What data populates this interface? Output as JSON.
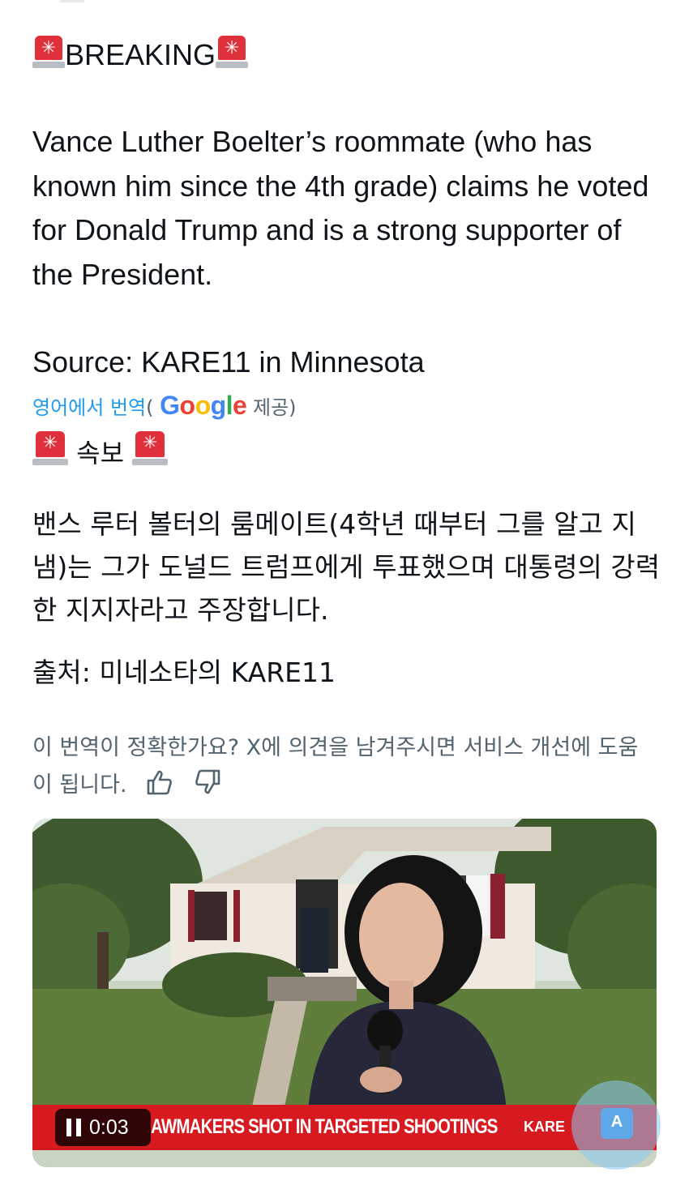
{
  "colors": {
    "link": "#1d9bf0",
    "muted": "#536471",
    "text": "#0f1419",
    "ticker_red": "#d71920"
  },
  "post": {
    "headline_word": "BREAKING",
    "headline_icon": "siren-icon",
    "body_en": "Vance Luther Boelter’s roommate (who has known him since the 4th grade) claims he voted for Donald Trump and is a strong supporter of the President.",
    "source_en": "Source: KARE11 in Minnesota"
  },
  "translation": {
    "translated_from": "영어에서 번역",
    "open_paren": "(",
    "provider_logo": "Google",
    "provided_by": "제공)",
    "headline_ko": "속보",
    "body_ko": "밴스 루터 볼터의 룸메이트(4학년 때부터 그를 알고 지냄)는 그가 도널드 트럼프에게 투표했으며 대통령의 강력한 지지자라고 주장합니다.",
    "source_ko": "출처: 미네소타의 KARE11",
    "feedback_prompt": "이 번역이 정확한가요? X에 의견을 남겨주시면 서비스 개선에 도움이 됩니다.",
    "thumbs_up_icon": "thumbs-up-icon",
    "thumbs_down_icon": "thumbs-down-icon"
  },
  "video": {
    "timestamp": "0:03",
    "ticker_text": "AWMAKERS SHOT IN TARGETED SHOOTINGS",
    "channel_logo": "KARE",
    "control_icon": "pause-icon"
  }
}
